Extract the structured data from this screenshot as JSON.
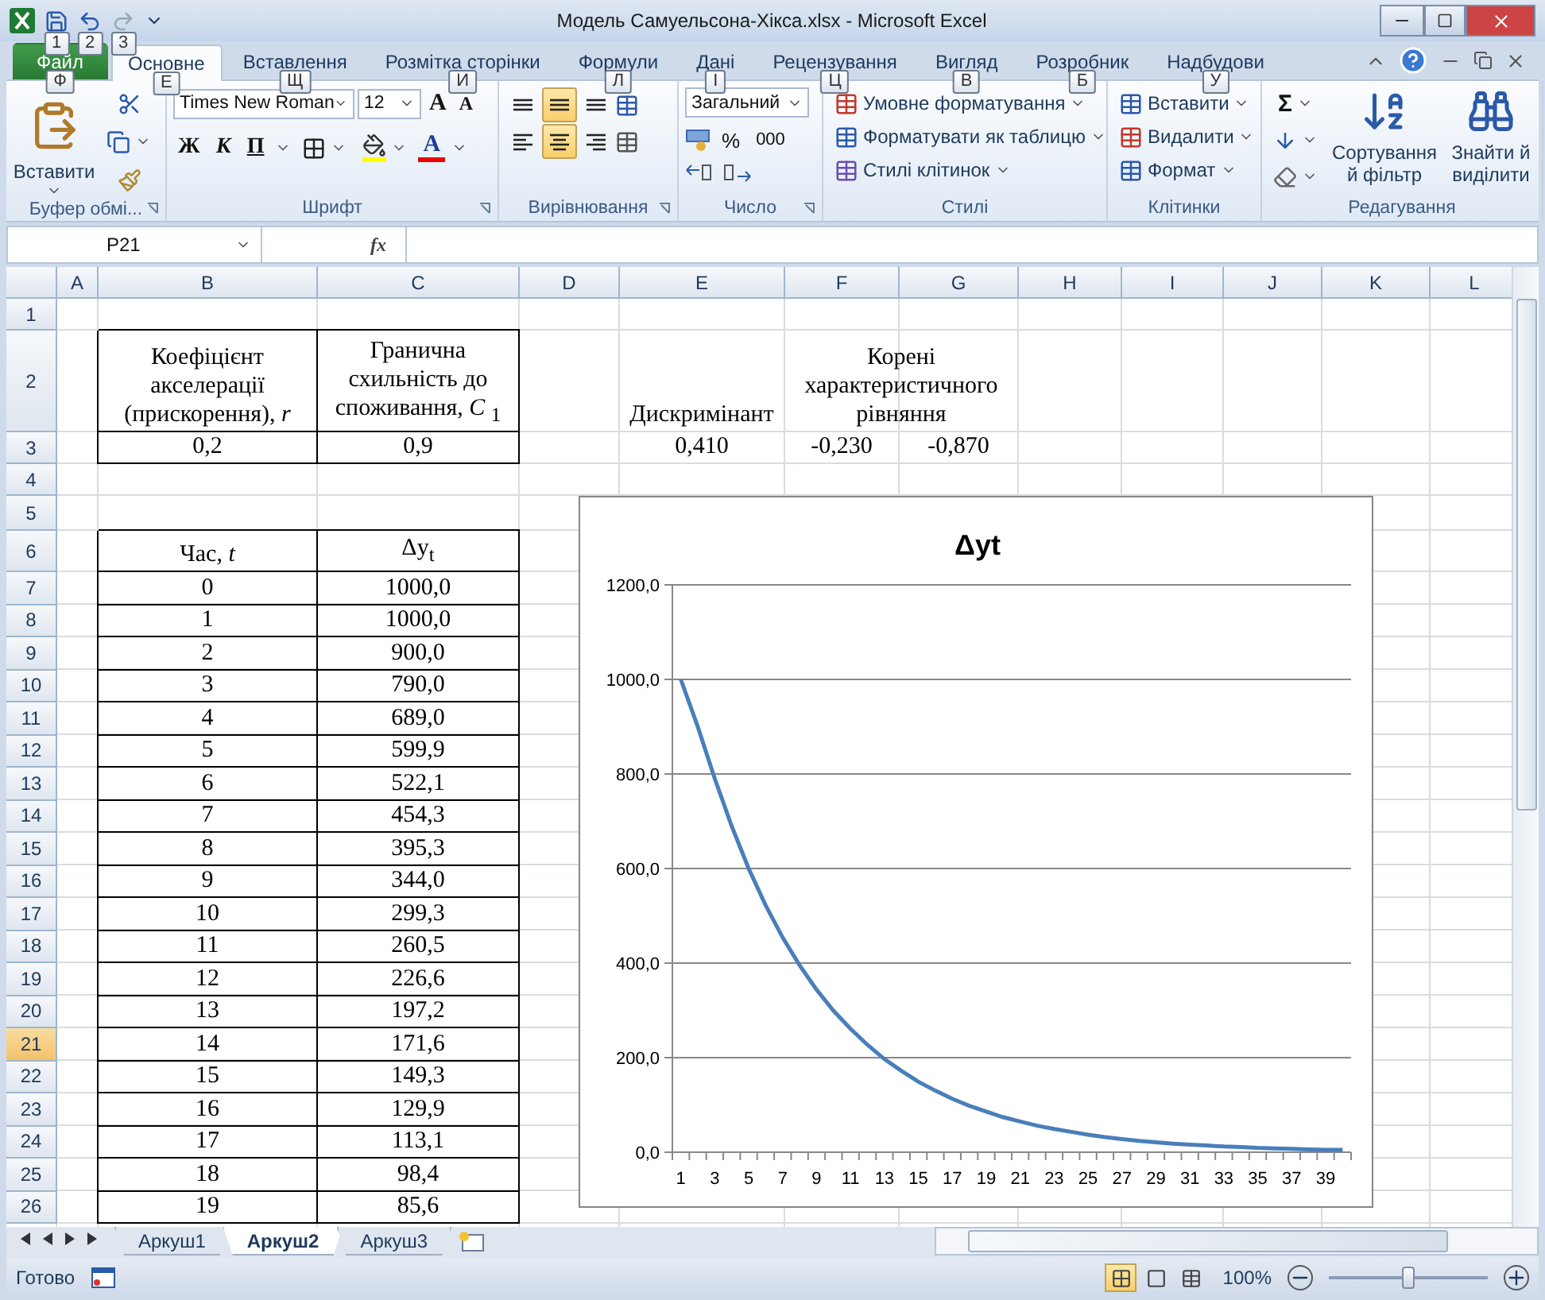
{
  "window": {
    "title": "Модель Самуельсона-Хікса.xlsx  -  Microsoft Excel"
  },
  "quick_access": {
    "keytips": [
      "1",
      "2",
      "3"
    ]
  },
  "ribbon_tabs": [
    {
      "label": "Файл",
      "keytip": "Ф",
      "kind": "file",
      "selected": false
    },
    {
      "label": "Основне",
      "keytip": "Е",
      "kind": "tab",
      "selected": true
    },
    {
      "label": "Вставлення",
      "keytip": "Щ",
      "kind": "tab",
      "selected": false
    },
    {
      "label": "Розмітка сторінки",
      "keytip": "И",
      "kind": "tab",
      "selected": false
    },
    {
      "label": "Формули",
      "keytip": "Л",
      "kind": "tab",
      "selected": false
    },
    {
      "label": "Дані",
      "keytip": "І",
      "kind": "tab",
      "selected": false
    },
    {
      "label": "Рецензування",
      "keytip": "Ц",
      "kind": "tab",
      "selected": false
    },
    {
      "label": "Вигляд",
      "keytip": "В",
      "kind": "tab",
      "selected": false
    },
    {
      "label": "Розробник",
      "keytip": "Б",
      "kind": "tab",
      "selected": false
    },
    {
      "label": "Надбудови",
      "keytip": "У",
      "kind": "tab",
      "selected": false
    }
  ],
  "clipboard": {
    "paste": "Вставити",
    "label": "Буфер обмі..."
  },
  "font": {
    "name": "Times New Roman",
    "size": "12",
    "grow": "A",
    "shrink": "A",
    "bold": "Ж",
    "italic": "К",
    "underline": "П",
    "font_color": "A",
    "label": "Шрифт"
  },
  "alignment": {
    "label": "Вирівнювання",
    "buttons": [
      {
        "kind": "top",
        "selected": false
      },
      {
        "kind": "middle",
        "selected": true
      },
      {
        "kind": "bottom",
        "selected": false
      },
      {
        "kind": "left",
        "selected": false
      },
      {
        "kind": "center",
        "selected": true
      },
      {
        "kind": "right",
        "selected": false
      }
    ]
  },
  "number": {
    "format": "Загальний",
    "percent": "%",
    "thousands": "000",
    "label": "Число"
  },
  "styles": {
    "items": [
      "Умовне форматування",
      "Форматувати як таблицю",
      "Стилі клітинок"
    ],
    "label": "Стилі"
  },
  "cells": {
    "items": [
      "Вставити",
      "Видалити",
      "Формат"
    ],
    "label": "Клітинки"
  },
  "editing": {
    "sum": "Σ",
    "sort": "Сортування й фільтр",
    "find": "Знайти й виділити",
    "label": "Редагування"
  },
  "formula_bar": {
    "name_box": "P21",
    "fx": "fx"
  },
  "sheet": {
    "columns": [
      "A",
      "B",
      "C",
      "D",
      "E",
      "F",
      "G",
      "H",
      "I",
      "J",
      "K",
      "L"
    ],
    "rows": [
      {
        "label": "1",
        "selected": false
      },
      {
        "label": "2",
        "selected": false
      },
      {
        "label": "3",
        "selected": false
      },
      {
        "label": "4",
        "selected": false
      },
      {
        "label": "5",
        "selected": false
      },
      {
        "label": "6",
        "selected": false
      },
      {
        "label": "7",
        "selected": false
      },
      {
        "label": "8",
        "selected": false
      },
      {
        "label": "9",
        "selected": false
      },
      {
        "label": "10",
        "selected": false
      },
      {
        "label": "11",
        "selected": false
      },
      {
        "label": "12",
        "selected": false
      },
      {
        "label": "13",
        "selected": false
      },
      {
        "label": "14",
        "selected": false
      },
      {
        "label": "15",
        "selected": false
      },
      {
        "label": "16",
        "selected": false
      },
      {
        "label": "17",
        "selected": false
      },
      {
        "label": "18",
        "selected": false
      },
      {
        "label": "19",
        "selected": false
      },
      {
        "label": "20",
        "selected": false
      },
      {
        "label": "21",
        "selected": true
      },
      {
        "label": "22",
        "selected": false
      },
      {
        "label": "23",
        "selected": false
      },
      {
        "label": "24",
        "selected": false
      },
      {
        "label": "25",
        "selected": false
      },
      {
        "label": "26",
        "selected": false
      }
    ],
    "params_table": {
      "headers": [
        "Коефіцієнт акселерації (прискорення), *r*",
        "Гранична схильність до споживання, *C* $_{1}$"
      ],
      "values": [
        "0,2",
        "0,9"
      ]
    },
    "discriminant": {
      "label": "Дискримінант",
      "value": "0,410"
    },
    "roots": {
      "label": "Корені характеристичного рівняння",
      "values": [
        "-0,230",
        "-0,870"
      ]
    },
    "series_table": {
      "headers": [
        "Час, *t*",
        "Δy$_{t}$"
      ],
      "rows": [
        [
          "0",
          "1000,0"
        ],
        [
          "1",
          "1000,0"
        ],
        [
          "2",
          "900,0"
        ],
        [
          "3",
          "790,0"
        ],
        [
          "4",
          "689,0"
        ],
        [
          "5",
          "599,9"
        ],
        [
          "6",
          "522,1"
        ],
        [
          "7",
          "454,3"
        ],
        [
          "8",
          "395,3"
        ],
        [
          "9",
          "344,0"
        ],
        [
          "10",
          "299,3"
        ],
        [
          "11",
          "260,5"
        ],
        [
          "12",
          "226,6"
        ],
        [
          "13",
          "197,2"
        ],
        [
          "14",
          "171,6"
        ],
        [
          "15",
          "149,3"
        ],
        [
          "16",
          "129,9"
        ],
        [
          "17",
          "113,1"
        ],
        [
          "18",
          "98,4"
        ],
        [
          "19",
          "85,6"
        ]
      ]
    },
    "chart": {
      "chart_data": {
        "type": "line",
        "title": "Δyt",
        "x": [
          1,
          2,
          3,
          4,
          5,
          6,
          7,
          8,
          9,
          10,
          11,
          12,
          13,
          14,
          15,
          16,
          17,
          18,
          19,
          20,
          21,
          22,
          23,
          24,
          25,
          26,
          27,
          28,
          29,
          30,
          31,
          32,
          33,
          34,
          35,
          36,
          37,
          38,
          39,
          40
        ],
        "series": [
          {
            "color": "#4a7ebb",
            "values": [
              1000,
              900,
              790,
              689,
              600,
              522,
              454,
              395,
              344,
              299,
              261,
              227,
              197,
              172,
              149,
              130,
              113,
              98,
              86,
              74,
              65,
              56,
              49,
              43,
              37,
              32,
              28,
              24,
              21,
              18,
              16,
              14,
              12,
              11,
              9,
              8,
              7,
              6,
              5,
              5
            ]
          }
        ],
        "grid": true,
        "xlim": [
          0.5,
          40.5
        ],
        "ylim": [
          0,
          1200
        ],
        "yticks": [
          {
            "value": 0,
            "label": "0,0"
          },
          {
            "value": 200,
            "label": "200,0"
          },
          {
            "value": 400,
            "label": "400,0"
          },
          {
            "value": 600,
            "label": "600,0"
          },
          {
            "value": 800,
            "label": "800,0"
          },
          {
            "value": 1000,
            "label": "1000,0"
          },
          {
            "value": 1200,
            "label": "1200,0"
          }
        ],
        "xticks": [
          1,
          3,
          5,
          7,
          9,
          11,
          13,
          15,
          17,
          19,
          21,
          23,
          25,
          27,
          29,
          31,
          33,
          35,
          37,
          39
        ]
      }
    }
  },
  "sheet_tabs": [
    {
      "label": "Аркуш1",
      "selected": false
    },
    {
      "label": "Аркуш2",
      "selected": true
    },
    {
      "label": "Аркуш3",
      "selected": false
    }
  ],
  "status_bar": {
    "status": "Готово",
    "views": [
      {
        "kind": "normal",
        "selected": true
      },
      {
        "kind": "page_layout",
        "selected": false
      },
      {
        "kind": "page_break",
        "selected": false
      }
    ],
    "zoom": "100%",
    "zoom_slider": {
      "level": 0.5
    }
  }
}
